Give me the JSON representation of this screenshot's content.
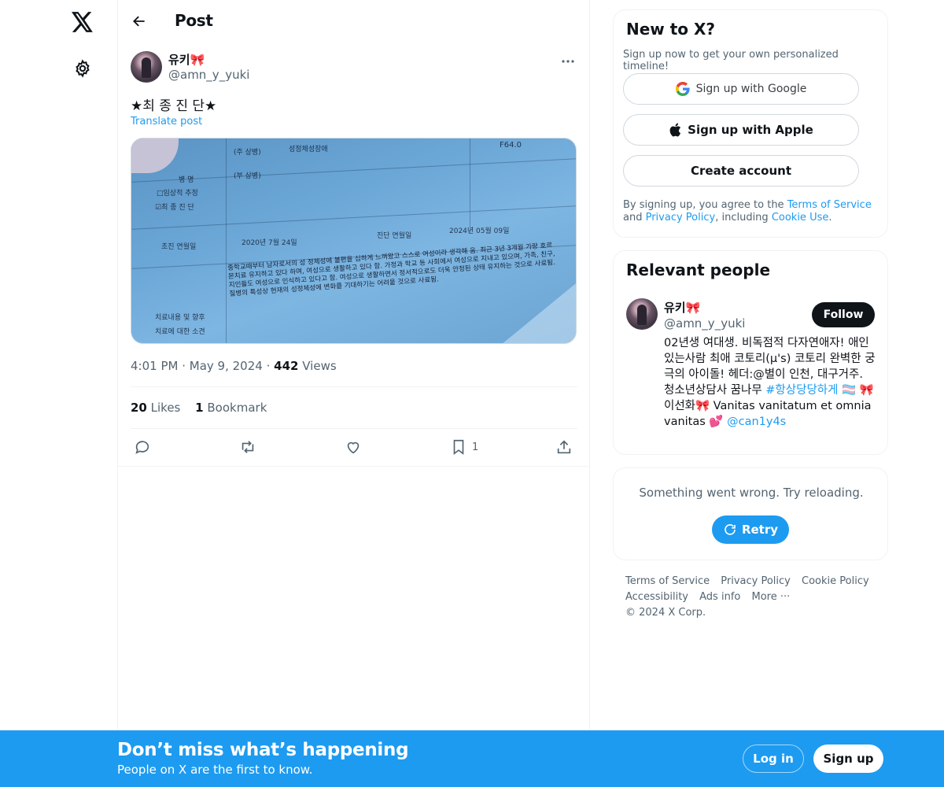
{
  "nav": {
    "logo_icon": "x-logo-icon",
    "settings_icon": "gear-icon"
  },
  "header": {
    "title": "Post",
    "back_icon": "arrow-left-icon"
  },
  "post": {
    "author_name": "유키🎀",
    "author_handle": "@amn_y_yuki",
    "text": "★최 종 진 단★",
    "translate_label": "Translate post",
    "time": "4:01 PM",
    "date": "May 9, 2024",
    "views_count": "442",
    "views_label": "Views",
    "likes_count": "20",
    "likes_label": "Likes",
    "bookmarks_count": "1",
    "bookmarks_label": "Bookmark",
    "bookmark_action_count": "1",
    "media_text": {
      "row1": "(주 상병)",
      "row1b": "성정체성장애",
      "code": "F64.0",
      "row2": "(부 상병)",
      "label_disease": "병 명",
      "label_presumed": "□임상적 추정",
      "label_final": "☑최 종 진 단",
      "label_first_visit": "초진 연월일",
      "first_visit_date": "2020년   7월   24일",
      "label_diagnosis": "진단 연월일",
      "diagnosis_date": "2024년   05월   09일",
      "paragraph": "중학교때부터 남자로서의 성 정체성에 불편을 심하게 느껴왔고 스스로 여성이라 생각해 옴. 최근 3년 3개월 가량 호르몬치료 유지하고 있다 하며, 여성으로 생활하고 있다 함. 가정과 학교 등 사회에서 여성으로 지내고 있으며, 가족, 친구, 지인들도 여성으로 인식하고 있다고 함. 여성으로 생활하면서 정서적으로도 더욱 안정된 상태 유지하는 것으로 사료됨. 질병의 특성상 현재의 성정체성에 변화를 기대하기는 어려울 것으로 사료됨.",
      "label_treatment": "치료내용 및 향후",
      "label_treatment2": "치료에 대한 소견"
    }
  },
  "sidebar": {
    "signup_card": {
      "title": "New to X?",
      "subtitle": "Sign up now to get your own personalized timeline!",
      "google_label": "Sign up with Google",
      "apple_label": "Sign up with Apple",
      "create_label": "Create account",
      "legal_prefix": "By signing up, you agree to the ",
      "terms_link": "Terms of Service",
      "and": " and ",
      "privacy_link": "Privacy Policy",
      "including": ", including ",
      "cookie_link": "Cookie Use",
      "period": "."
    },
    "relevant": {
      "title": "Relevant people",
      "name": "유키🎀",
      "handle": "@amn_y_yuki",
      "follow_label": "Follow",
      "bio_part1": "02년생 여대생. 비독점적 다자연애자! 애인있는사람 최애 코토리(μ's) 코토리 완벽한 궁극의 아이돌! 헤더:@별이 인천, 대구거주. 청소년상담사 꿈나무 ",
      "bio_hashtag": "#항상당당하게",
      "bio_part2": " 🏳️‍⚧️ 🎀이선화🎀 Vanitas vanitatum et omnia vanitas 💕 ",
      "bio_mention": "@can1y4s"
    },
    "error_card": {
      "message": "Something went wrong. Try reloading.",
      "retry_label": "Retry"
    },
    "footer": {
      "links": [
        "Terms of Service",
        "Privacy Policy",
        "Cookie Policy",
        "Accessibility",
        "Ads info",
        "More ···",
        "© 2024 X Corp."
      ]
    }
  },
  "banner": {
    "title": "Don’t miss what’s happening",
    "subtitle": "People on X are the first to know.",
    "login_label": "Log in",
    "signup_label": "Sign up"
  },
  "colors": {
    "accent": "#1d9bf0",
    "text": "#0f1419",
    "muted": "#536471",
    "border": "#eff3f4"
  }
}
